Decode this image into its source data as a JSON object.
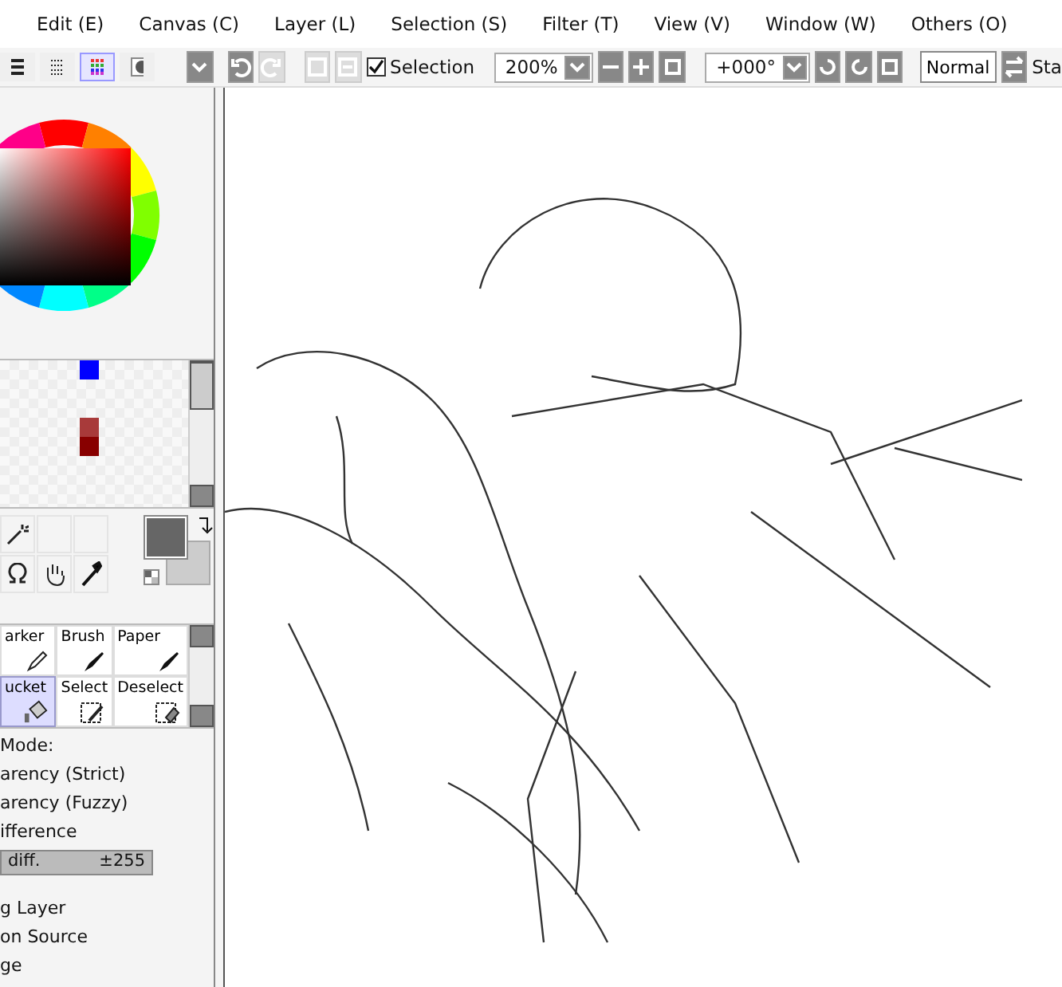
{
  "menu": [
    "Edit (E)",
    "Canvas (C)",
    "Layer (L)",
    "Selection (S)",
    "Filter (T)",
    "View (V)",
    "Window (W)",
    "Others (O)"
  ],
  "toolbar": {
    "view_modes": [
      {
        "selected": false
      },
      {
        "selected": false
      },
      {
        "selected": true
      },
      {
        "selected": false
      }
    ],
    "undo_disabled": false,
    "redo_disabled": true,
    "selection": {
      "label": "Selection",
      "checked": true
    },
    "zoom": "200%",
    "rotation": "+000°",
    "blend": "Normal",
    "cut_label": "Sta"
  },
  "brushes": [
    {
      "label": "arker",
      "selected": false,
      "kind": "pencil"
    },
    {
      "label": "Brush",
      "selected": false,
      "kind": "brush"
    },
    {
      "label": "Paper",
      "selected": false,
      "kind": "brush"
    },
    {
      "label": "ucket",
      "selected": true,
      "kind": "bucket"
    },
    {
      "label": "Select",
      "selected": false,
      "kind": "select"
    },
    {
      "label": "Deselect",
      "selected": false,
      "kind": "deselect"
    }
  ],
  "swatches": [
    {
      "color": "#0000ff"
    },
    {
      "color": "#a83a3a"
    },
    {
      "color": "#880000"
    }
  ],
  "tool_options": {
    "mode_label": "Mode:",
    "modes": [
      "arency (Strict)",
      "arency (Fuzzy)",
      "ifference"
    ],
    "slider": {
      "label": "diff.",
      "reading": "±255",
      "level": 1
    },
    "targets": [
      "g Layer",
      "on Source",
      "ge"
    ]
  }
}
